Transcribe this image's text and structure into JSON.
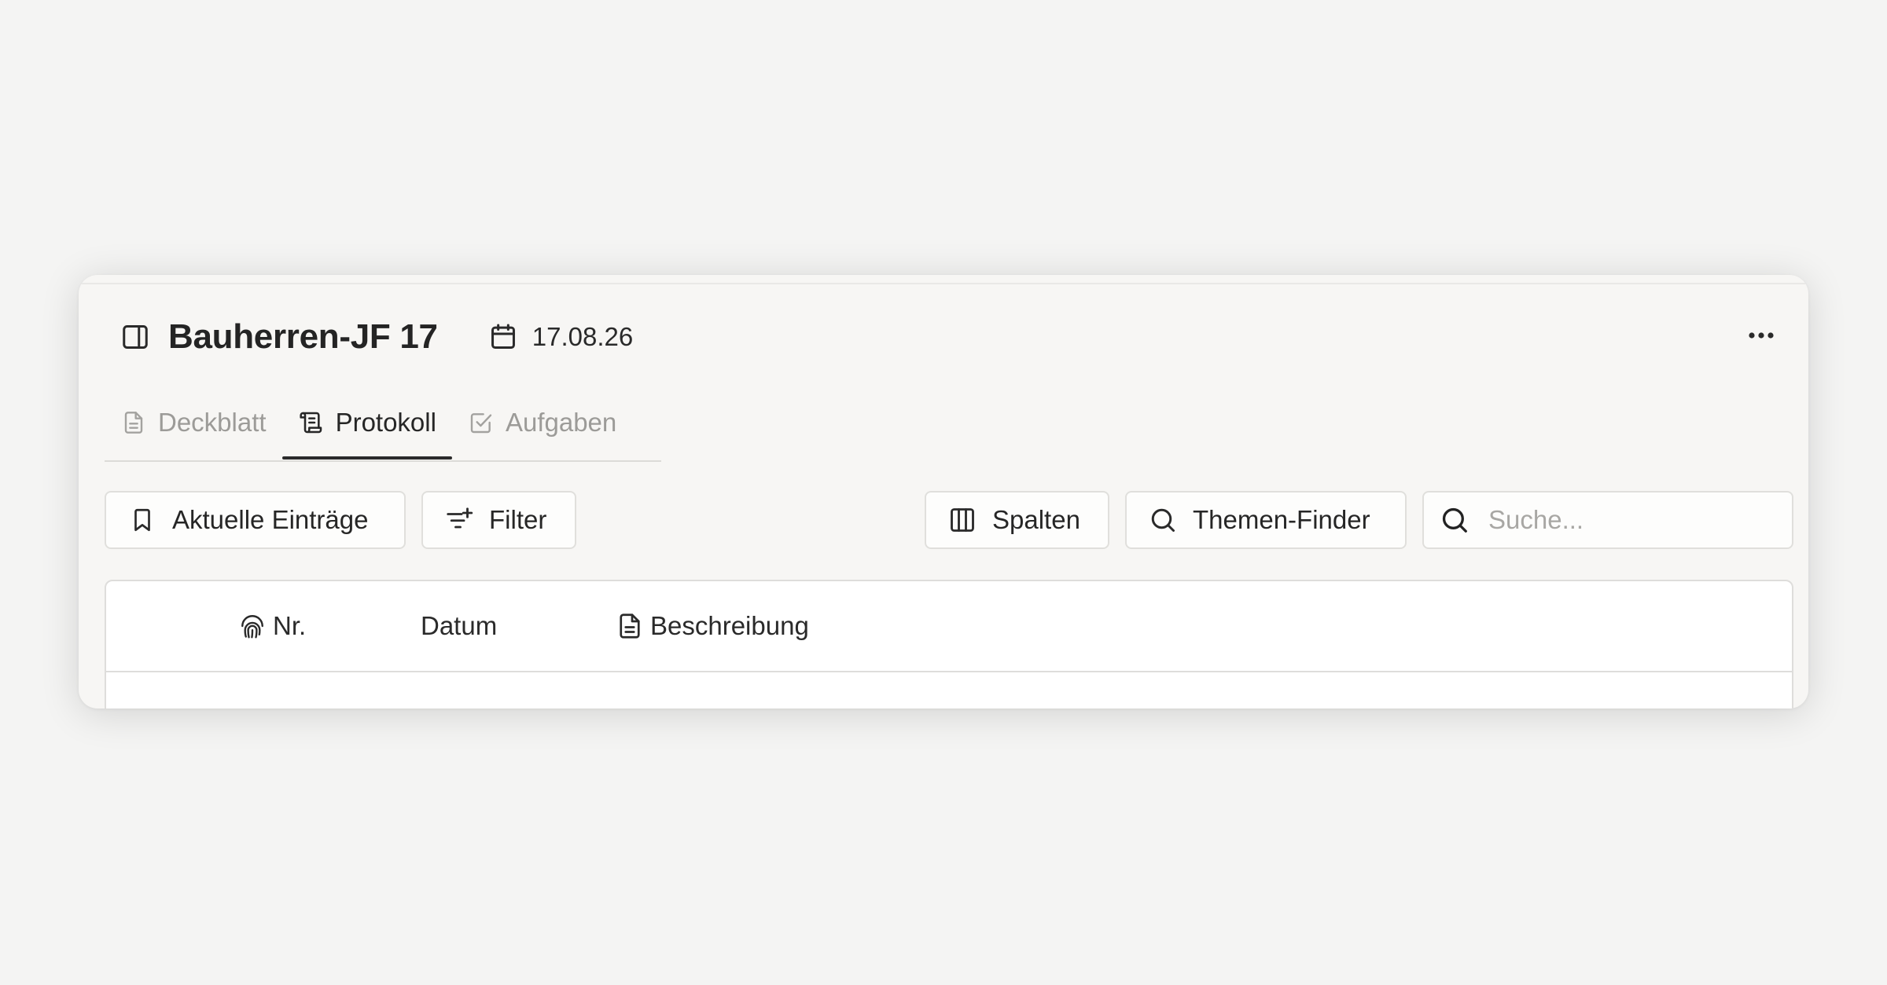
{
  "header": {
    "title": "Bauherren-JF 17",
    "date": "17.08.26",
    "icons": [
      "panel-left-icon",
      "calendar-icon",
      "more-horizontal-icon"
    ]
  },
  "tabs": [
    {
      "label": "Deckblatt",
      "icon": "document-icon",
      "active": false
    },
    {
      "label": "Protokoll",
      "icon": "scroll-icon",
      "active": true
    },
    {
      "label": "Aufgaben",
      "icon": "check-square-icon",
      "active": false
    }
  ],
  "toolbar": {
    "current_entries_label": "Aktuelle Einträge",
    "filter_label": "Filter",
    "columns_label": "Spalten",
    "topic_finder_label": "Themen-Finder",
    "search_placeholder": "Suche..."
  },
  "table": {
    "columns": [
      {
        "label": "Nr.",
        "icon": "fingerprint-icon"
      },
      {
        "label": "Datum",
        "icon": ""
      },
      {
        "label": "Beschreibung",
        "icon": "file-text-icon"
      }
    ]
  },
  "colors": {
    "background": "#f4f4f3",
    "card": "#f7f6f4",
    "active_tab_underline": "#2b2b2b",
    "inactive_tab_text": "#9c9b98",
    "border": "#e0dfdc"
  }
}
